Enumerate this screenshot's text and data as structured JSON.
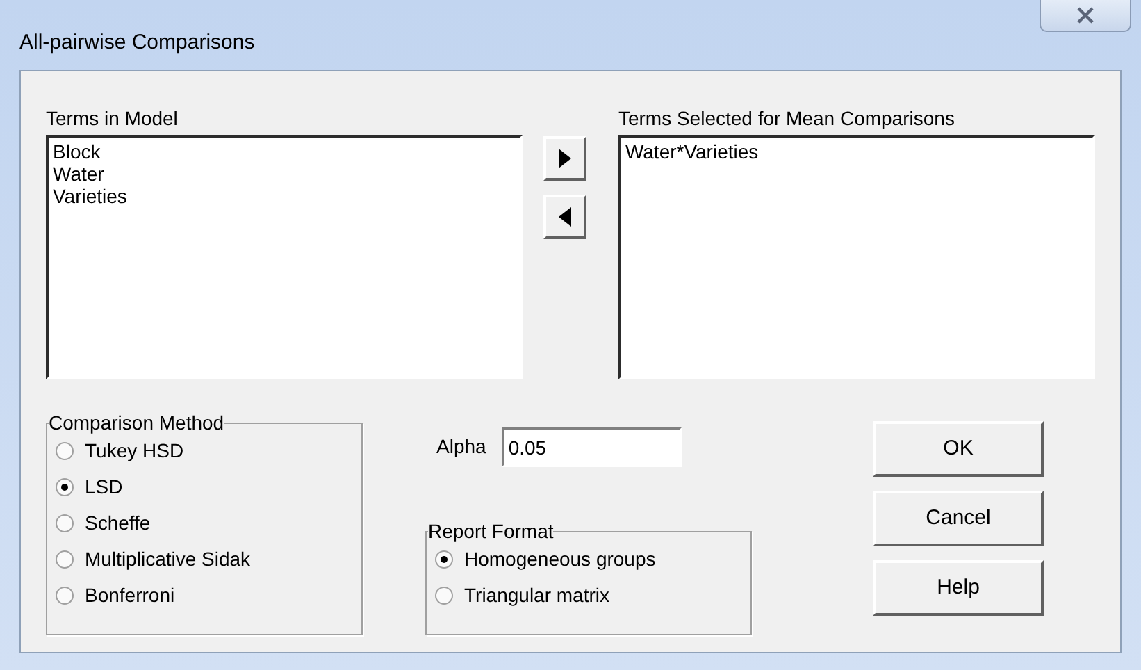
{
  "window": {
    "title": "All-pairwise Comparisons"
  },
  "terms_in_model": {
    "label": "Terms in Model",
    "items": [
      "Block",
      "Water",
      "Varieties"
    ]
  },
  "terms_selected": {
    "label": "Terms Selected for Mean Comparisons",
    "items": [
      "Water*Varieties"
    ]
  },
  "comparison_method": {
    "label": "Comparison Method",
    "options": [
      {
        "label": "Tukey HSD",
        "selected": false
      },
      {
        "label": "LSD",
        "selected": true
      },
      {
        "label": "Scheffe",
        "selected": false
      },
      {
        "label": "Multiplicative Sidak",
        "selected": false
      },
      {
        "label": "Bonferroni",
        "selected": false
      }
    ]
  },
  "alpha": {
    "label": "Alpha",
    "value": "0.05"
  },
  "report_format": {
    "label": "Report Format",
    "options": [
      {
        "label": "Homogeneous groups",
        "selected": true
      },
      {
        "label": "Triangular matrix",
        "selected": false
      }
    ]
  },
  "buttons": [
    "OK",
    "Cancel",
    "Help"
  ]
}
